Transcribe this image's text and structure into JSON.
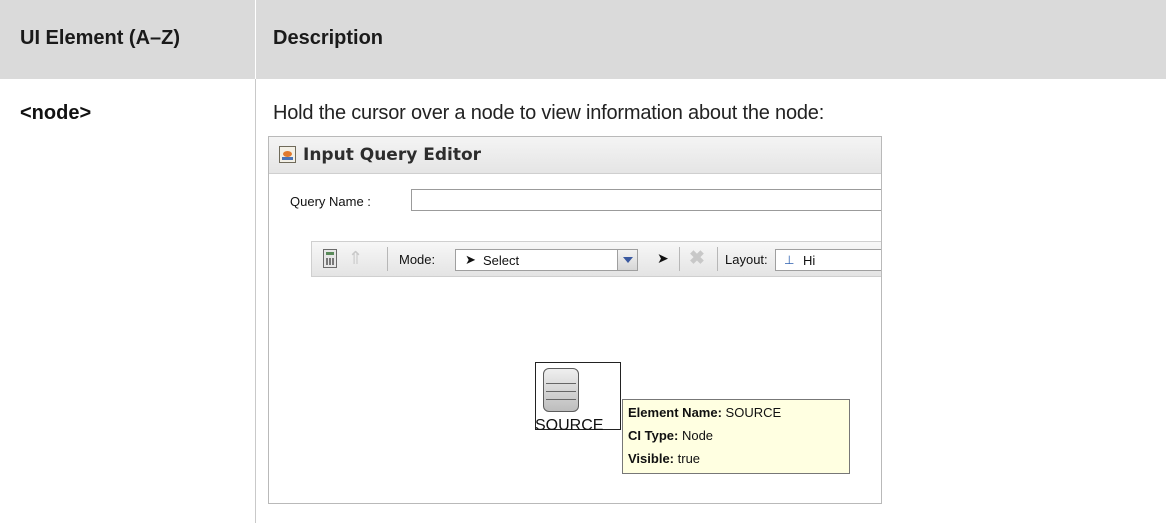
{
  "table": {
    "header": {
      "col_element": "UI Element (A–Z)",
      "col_description": "Description"
    },
    "rows": [
      {
        "element": "<node>",
        "description": "Hold the cursor over a node to view information about the node:"
      }
    ]
  },
  "screenshot": {
    "window_title": "Input Query Editor",
    "app_icon": "java-cup-icon",
    "query_name_label": "Query Name :",
    "query_name_value": "",
    "toolbar": {
      "mode_label": "Mode:",
      "mode_value": "Select",
      "layout_label": "Layout:",
      "layout_value": "Hi",
      "icons": [
        "calculator-icon",
        "up-arrow-icon",
        "pointer-icon",
        "delete-icon",
        "hierarchy-icon"
      ]
    },
    "node": {
      "label": "SOURCE",
      "icon": "database-icon"
    },
    "tooltip": {
      "element_name_key": "Element Name:",
      "element_name_value": "SOURCE",
      "ci_type_key": "CI Type:",
      "ci_type_value": "Node",
      "visible_key": "Visible:",
      "visible_value": "true"
    }
  }
}
